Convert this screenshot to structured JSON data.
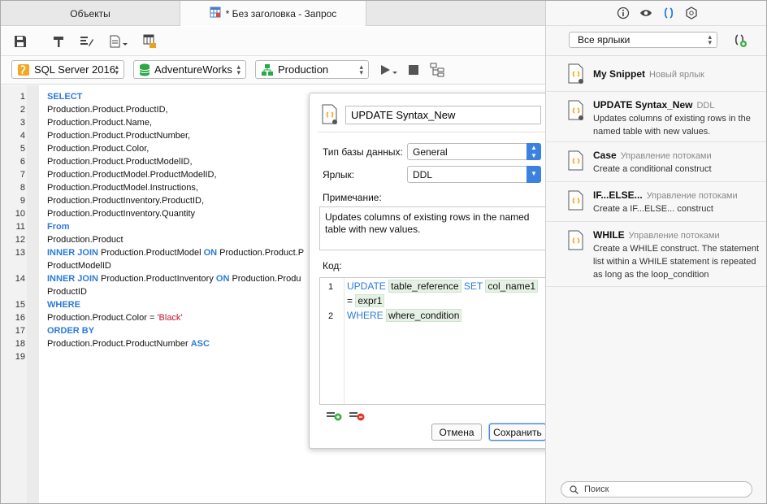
{
  "tabs": {
    "objects": "Объекты",
    "query": "* Без заголовка - Запрос"
  },
  "connection": {
    "server": "SQL Server 2016",
    "database": "AdventureWorks",
    "schema": "Production"
  },
  "editor": {
    "line_numbers": [
      "1",
      "2",
      "3",
      "4",
      "5",
      "6",
      "7",
      "8",
      "9",
      "10",
      "11",
      "12",
      "13",
      "",
      "14",
      "",
      "15",
      "16",
      "17",
      "18",
      "19"
    ],
    "lines": [
      {
        "kw": "SELECT",
        "t": "",
        "kw2": "",
        "t2": ""
      },
      {
        "kw": "",
        "t": "Production.Product.ProductID,",
        "kw2": "",
        "t2": ""
      },
      {
        "kw": "",
        "t": "Production.Product.Name,",
        "kw2": "",
        "t2": ""
      },
      {
        "kw": "",
        "t": "Production.Product.ProductNumber,",
        "kw2": "",
        "t2": ""
      },
      {
        "kw": "",
        "t": "Production.Product.Color,",
        "kw2": "",
        "t2": ""
      },
      {
        "kw": "",
        "t": "Production.Product.ProductModelID,",
        "kw2": "",
        "t2": ""
      },
      {
        "kw": "",
        "t": "Production.ProductModel.ProductModelID,",
        "kw2": "",
        "t2": ""
      },
      {
        "kw": "",
        "t": "Production.ProductModel.Instructions,",
        "kw2": "",
        "t2": ""
      },
      {
        "kw": "",
        "t": "Production.ProductInventory.ProductID,",
        "kw2": "",
        "t2": ""
      },
      {
        "kw": "",
        "t": "Production.ProductInventory.Quantity",
        "kw2": "",
        "t2": ""
      },
      {
        "kw": "From",
        "t": "",
        "kw2": "",
        "t2": ""
      },
      {
        "kw": "",
        "t": "Production.Product",
        "kw2": "",
        "t2": ""
      },
      {
        "kw": "INNER JOIN",
        "t": " Production.ProductModel ",
        "kw2": "ON",
        "t2": " Production.Product.P"
      },
      {
        "kw": "",
        "t": "ProductModelID",
        "kw2": "",
        "t2": ""
      },
      {
        "kw": "INNER JOIN",
        "t": " Production.ProductInventory ",
        "kw2": "ON",
        "t2": " Production.Produ"
      },
      {
        "kw": "",
        "t": "ProductID",
        "kw2": "",
        "t2": ""
      },
      {
        "kw": "WHERE",
        "t": "",
        "kw2": "",
        "t2": ""
      },
      {
        "kw": "",
        "t": "Production.Product.Color = ",
        "kw2": "",
        "t2": "",
        "str": "'Black'"
      },
      {
        "kw": "ORDER BY",
        "t": "",
        "kw2": "",
        "t2": ""
      },
      {
        "kw": "",
        "t": "Production.Product.ProductNumber ",
        "kw2": "ASC",
        "t2": ""
      },
      {
        "kw": "",
        "t": "",
        "kw2": "",
        "t2": ""
      }
    ]
  },
  "popup": {
    "name": "UPDATE Syntax_New",
    "db_type_label": "Тип базы данных:",
    "db_type_value": "General",
    "label_label": "Ярлык:",
    "label_value": "DDL",
    "note_label": "Примечание:",
    "note_text": "Updates columns of existing rows in the named table with new values.",
    "code_label": "Код:",
    "code": {
      "l1_kw": "UPDATE",
      "l1_ph1": "table_reference",
      "l1_kw2": "SET",
      "l1_ph2": "col_name1",
      "l1b_t": "= ",
      "l1b_ph": "expr1",
      "l2_kw": "WHERE",
      "l2_ph": "where_condition"
    },
    "cancel": "Отмена",
    "save": "Сохранить"
  },
  "right_panel": {
    "filter": "Все ярлыки",
    "search_placeholder": "Поиск",
    "snippets": [
      {
        "title": "My Snippet",
        "label": "Новый ярлык",
        "desc": ""
      },
      {
        "title": "UPDATE Syntax_New",
        "label": "DDL",
        "desc": "Updates columns of existing rows in the named table with new values."
      },
      {
        "title": "Case",
        "label": "Управление потоками",
        "desc": "Create a conditional construct"
      },
      {
        "title": "IF...ELSE...",
        "label": "Управление потоками",
        "desc": "Create a IF...ELSE... construct"
      },
      {
        "title": "WHILE",
        "label": "Управление потоками",
        "desc": "Create a WHILE construct. The statement list within a WHILE statement is repeated as long as the loop_condition expression..."
      }
    ]
  },
  "colors": {
    "keyword": "#2e7bd6",
    "string": "#c2152a",
    "snippet_icon": "#f5a623",
    "accent": "#3b82e0"
  }
}
